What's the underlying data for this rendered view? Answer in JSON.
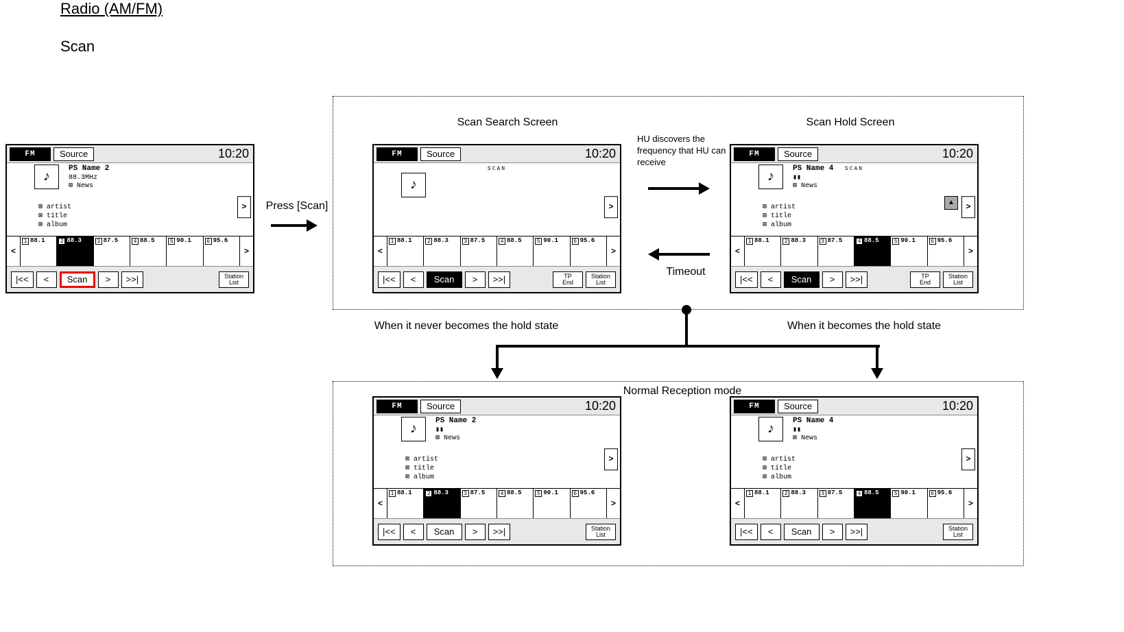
{
  "page": {
    "title": "Radio (AM/FM)",
    "subtitle": "Scan"
  },
  "labels": {
    "scan_search_screen": "Scan Search Screen",
    "scan_hold_screen": "Scan Hold Screen",
    "press_scan": "Press [Scan]",
    "hu_discover": "HU discovers the frequency that HU can receive",
    "timeout": "Timeout",
    "never_hold": "When it never becomes the hold state",
    "becomes_hold": "When it becomes the hold state",
    "normal_reception": "Normal Reception mode"
  },
  "common": {
    "band": "FM",
    "source": "Source",
    "clock": "10:20",
    "scan_tag": "SCAN",
    "presets": [
      {
        "n": "1",
        "f": "88.1"
      },
      {
        "n": "2",
        "f": "88.3"
      },
      {
        "n": "3",
        "f": "87.5"
      },
      {
        "n": "4",
        "f": "88.5"
      },
      {
        "n": "5",
        "f": "90.1"
      },
      {
        "n": "6",
        "f": "95.6"
      }
    ],
    "btn": {
      "first": "|<<",
      "prev": "<",
      "scan": "Scan",
      "next": ">",
      "last": ">>|",
      "tp": "TP",
      "end": "End",
      "station": "Station",
      "list": "List"
    },
    "side_next": ">"
  },
  "screens": {
    "s1": {
      "ps_name": "PS Name 2",
      "freq": "88.3MHz",
      "pty": "News",
      "meta": {
        "a": "artist",
        "t": "title",
        "al": "album"
      },
      "active_preset": 1
    },
    "s2": {
      "active_preset": -1
    },
    "s3": {
      "ps_name": "PS Name 4",
      "freq_pic": "▮▮",
      "pty": "News",
      "meta": {
        "a": "artist",
        "t": "title",
        "al": "album"
      },
      "active_preset": 3
    },
    "s4": {
      "ps_name": "PS Name 2",
      "freq_pic": "▮▮",
      "pty": "News",
      "meta": {
        "a": "artist",
        "t": "title",
        "al": "album"
      },
      "active_preset": 1
    },
    "s5": {
      "ps_name": "PS Name 4",
      "freq_pic": "▮▮",
      "pty": "News",
      "meta": {
        "a": "artist",
        "t": "title",
        "al": "album"
      },
      "active_preset": 3
    }
  }
}
